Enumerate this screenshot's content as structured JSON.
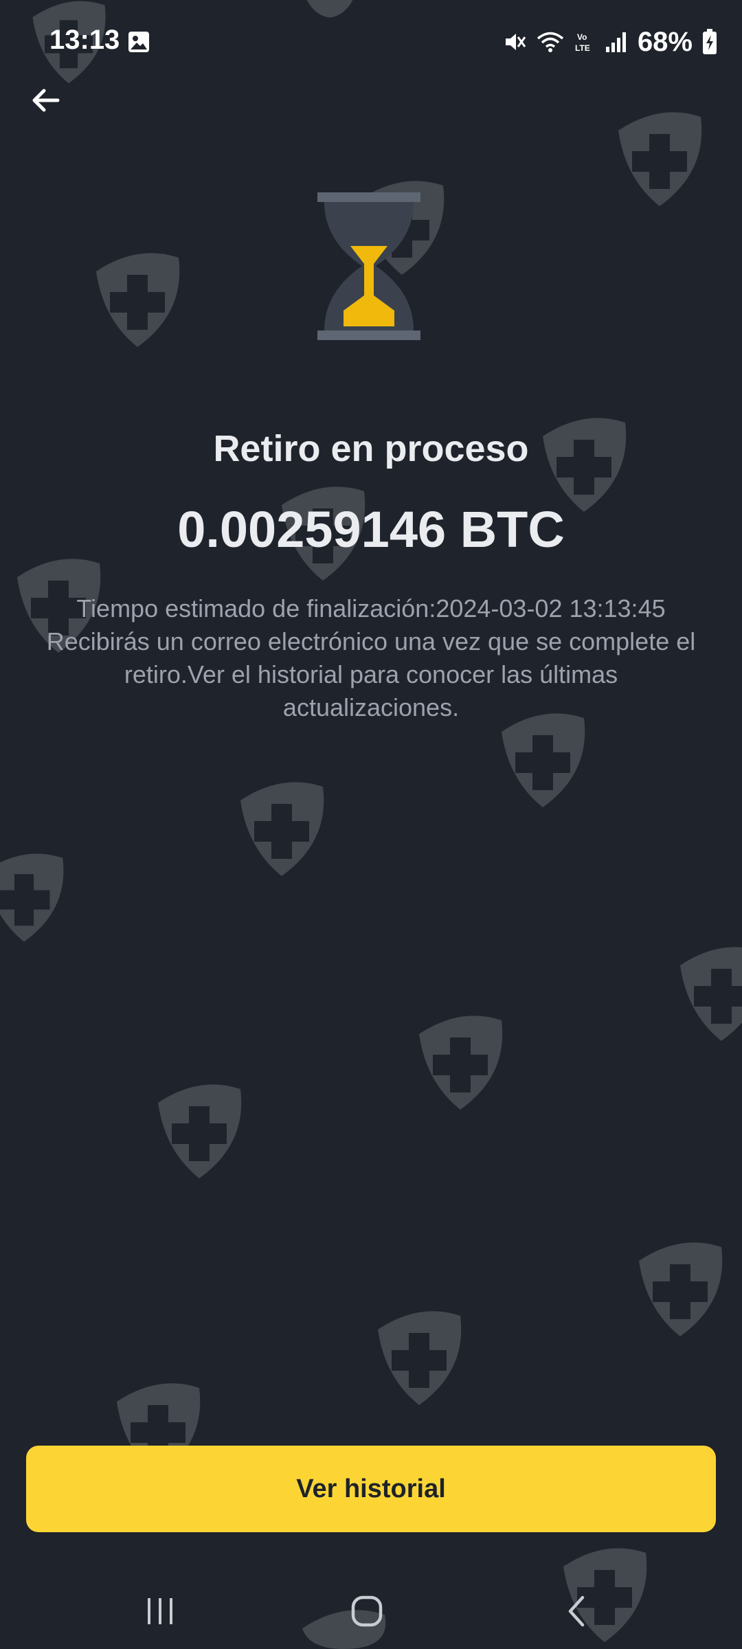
{
  "status_bar": {
    "time": "13:13",
    "battery": "68%",
    "icons": [
      "gallery-icon",
      "mute-icon",
      "wifi-icon",
      "volte-icon",
      "signal-icon",
      "battery-icon"
    ]
  },
  "header": {
    "back_icon": "arrow-left-icon"
  },
  "main": {
    "status_icon": "hourglass-icon",
    "title": "Retiro en proceso",
    "amount": "0.00259146 BTC",
    "estimated_time": "Tiempo estimado de finalización:2024-03-02 13:13:45",
    "message": "Recibirás un correo electrónico una vez que se complete el retiro.Ver el historial para conocer las últimas actualizaciones."
  },
  "actions": {
    "primary_label": "Ver historial"
  },
  "nav_bar": {
    "items": [
      "recent-apps-icon",
      "home-icon",
      "back-icon"
    ]
  },
  "colors": {
    "background": "#1f232b",
    "accent": "#fcd535",
    "text_primary": "#eaecef",
    "text_secondary": "#9da3ae"
  }
}
